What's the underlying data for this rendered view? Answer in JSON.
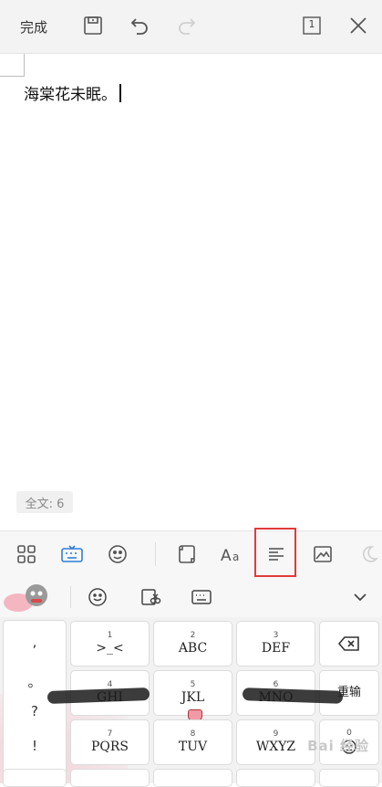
{
  "topbar": {
    "done_label": "完成",
    "page_indicator": "1"
  },
  "document": {
    "text": "海棠花未眠。"
  },
  "status": {
    "word_count": "全文: 6"
  },
  "colors": {
    "accent_blue": "#2f7fd6",
    "highlight_red": "#e23a3a",
    "icon_gray": "#555555"
  },
  "keyboard": {
    "rows": [
      [
        {
          "num": "1",
          "label": ">_<"
        },
        {
          "num": "2",
          "label": "ABC"
        },
        {
          "num": "3",
          "label": "DEF"
        }
      ],
      [
        {
          "num": "4",
          "label": "GHI"
        },
        {
          "num": "5",
          "label": "JKL"
        },
        {
          "num": "6",
          "label": "MNO"
        }
      ],
      [
        {
          "num": "7",
          "label": "PQRS"
        },
        {
          "num": "8",
          "label": "TUV"
        },
        {
          "num": "9",
          "label": "WXYZ"
        }
      ]
    ],
    "symbols": [
      ",",
      "。",
      "?",
      "!"
    ],
    "reenter_label": "重输",
    "emoji_key_num": "0"
  },
  "watermark": "Bai 经验"
}
